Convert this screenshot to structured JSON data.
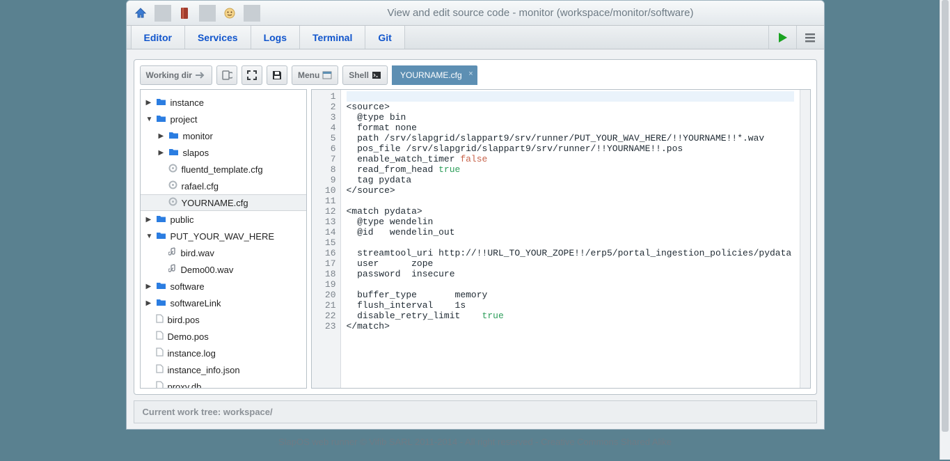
{
  "title": "View and edit source code - monitor (workspace/monitor/software)",
  "nav": {
    "tabs": [
      "Editor",
      "Services",
      "Logs",
      "Terminal",
      "Git"
    ]
  },
  "toolbar": {
    "working_dir": "Working dir",
    "menu": "Menu",
    "shell": "Shell",
    "active_file_tab": "YOURNAME.cfg"
  },
  "tree": [
    {
      "depth": 0,
      "toggle": "▶",
      "icon": "folder",
      "label": "instance"
    },
    {
      "depth": 0,
      "toggle": "▼",
      "icon": "folder",
      "label": "project"
    },
    {
      "depth": 1,
      "toggle": "▶",
      "icon": "folder",
      "label": "monitor"
    },
    {
      "depth": 1,
      "toggle": "▶",
      "icon": "folder",
      "label": "slapos"
    },
    {
      "depth": 1,
      "toggle": "",
      "icon": "cfg",
      "label": "fluentd_template.cfg"
    },
    {
      "depth": 1,
      "toggle": "",
      "icon": "cfg",
      "label": "rafael.cfg"
    },
    {
      "depth": 1,
      "toggle": "",
      "icon": "cfg",
      "label": "YOURNAME.cfg",
      "selected": true
    },
    {
      "depth": 0,
      "toggle": "▶",
      "icon": "folder",
      "label": "public"
    },
    {
      "depth": 0,
      "toggle": "▼",
      "icon": "folder",
      "label": "PUT_YOUR_WAV_HERE"
    },
    {
      "depth": 1,
      "toggle": "",
      "icon": "wav",
      "label": "bird.wav"
    },
    {
      "depth": 1,
      "toggle": "",
      "icon": "wav",
      "label": "Demo00.wav"
    },
    {
      "depth": 0,
      "toggle": "▶",
      "icon": "folder",
      "label": "software"
    },
    {
      "depth": 0,
      "toggle": "▶",
      "icon": "folder",
      "label": "softwareLink"
    },
    {
      "depth": 0,
      "toggle": "",
      "icon": "file",
      "label": "bird.pos"
    },
    {
      "depth": 0,
      "toggle": "",
      "icon": "file",
      "label": "Demo.pos"
    },
    {
      "depth": 0,
      "toggle": "",
      "icon": "file",
      "label": "instance.log"
    },
    {
      "depth": 0,
      "toggle": "",
      "icon": "file",
      "label": "instance_info.json"
    },
    {
      "depth": 0,
      "toggle": "",
      "icon": "file",
      "label": "proxy.db"
    }
  ],
  "code": {
    "lines": [
      {
        "n": 1,
        "t": "",
        "hl": true
      },
      {
        "n": 2,
        "t": "<source>"
      },
      {
        "n": 3,
        "t": "  @type bin"
      },
      {
        "n": 4,
        "t": "  format none"
      },
      {
        "n": 5,
        "t": "  path /srv/slapgrid/slappart9/srv/runner/PUT_YOUR_WAV_HERE/!!YOURNAME!!*.wav"
      },
      {
        "n": 6,
        "t": "  pos_file /srv/slapgrid/slappart9/srv/runner/!!YOURNAME!!.pos"
      },
      {
        "n": 7,
        "t": "  enable_watch_timer ",
        "kw": "false"
      },
      {
        "n": 8,
        "t": "  read_from_head ",
        "kw": "true"
      },
      {
        "n": 9,
        "t": "  tag pydata"
      },
      {
        "n": 10,
        "t": "</source>"
      },
      {
        "n": 11,
        "t": ""
      },
      {
        "n": 12,
        "t": "<match pydata>"
      },
      {
        "n": 13,
        "t": "  @type wendelin"
      },
      {
        "n": 14,
        "t": "  @id   wendelin_out"
      },
      {
        "n": 15,
        "t": ""
      },
      {
        "n": 16,
        "t": "  streamtool_uri http://!!URL_TO_YOUR_ZOPE!!/erp5/portal_ingestion_policies/pydata"
      },
      {
        "n": 17,
        "t": "  user      zope"
      },
      {
        "n": 18,
        "t": "  password  insecure"
      },
      {
        "n": 19,
        "t": ""
      },
      {
        "n": 20,
        "t": "  buffer_type       memory"
      },
      {
        "n": 21,
        "t": "  flush_interval    1s"
      },
      {
        "n": 22,
        "t": "  disable_retry_limit    ",
        "kw": "true"
      },
      {
        "n": 23,
        "t": "</match>"
      }
    ]
  },
  "status": "Current work tree: workspace/",
  "footer": "SlapOS web runner © Vifib SARL 2011-2014 - All right reserved - Creative Commons Shared Alike"
}
